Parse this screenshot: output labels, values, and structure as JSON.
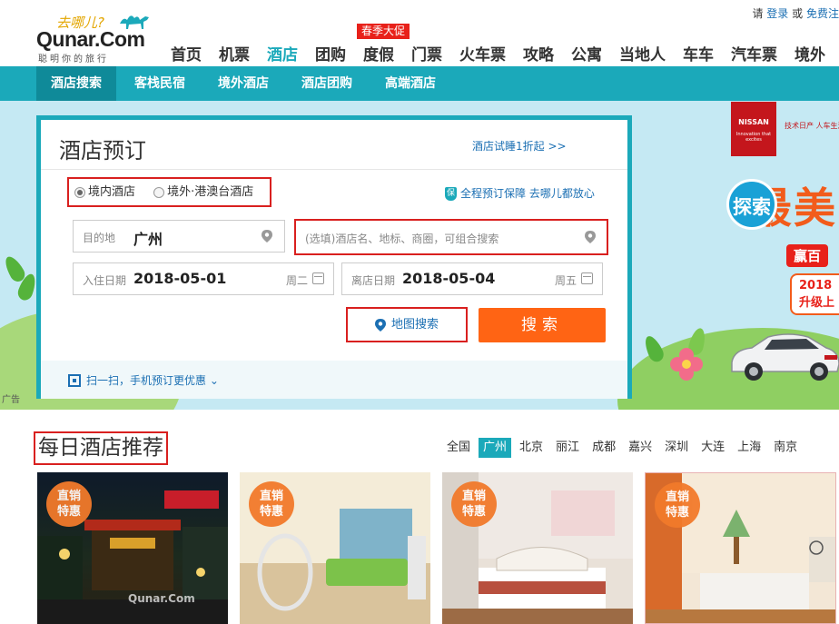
{
  "header": {
    "logo_slogan": "去哪儿?",
    "logo_name": "Qunar.Com",
    "logo_tagline": "聪明你的旅行",
    "top_links": {
      "prefix": "请",
      "login": "登录",
      "or": "或",
      "register": "免费注"
    },
    "promo_badge": "春季大促",
    "nav": [
      "首页",
      "机票",
      "酒店",
      "团购",
      "度假",
      "门票",
      "火车票",
      "攻略",
      "公寓",
      "当地人",
      "车车",
      "汽车票",
      "境外"
    ],
    "nav_active": "酒店"
  },
  "subnav": {
    "items": [
      "酒店搜索",
      "客栈民宿",
      "境外酒店",
      "酒店团购",
      "高端酒店"
    ],
    "active": "酒店搜索"
  },
  "hero_ad": {
    "brand": "NISSAN",
    "brand_small": "Innovation that excites",
    "tagline": "技术日产 人车生活",
    "explore": "探索",
    "big_word": "最美",
    "win_text": "赢百",
    "year_text": "2018",
    "upgrade_text": "升级上",
    "ad_label": "广告"
  },
  "booking": {
    "title": "酒店预订",
    "trial_link": "酒店试睡1折起 >>",
    "radio_domestic": "境内酒店",
    "radio_overseas": "境外·港澳台酒店",
    "guarantee": "全程预订保障 去哪儿都放心",
    "destination_label": "目的地",
    "destination_value": "广州",
    "keyword_placeholder": "(选填)酒店名、地标、商圈，可组合搜索",
    "checkin_label": "入住日期",
    "checkin_date": "2018-05-01",
    "checkin_day": "周二",
    "checkout_label": "离店日期",
    "checkout_date": "2018-05-04",
    "checkout_day": "周五",
    "map_search": "地图搜索",
    "search": "搜索",
    "scan_text": "扫一扫，手机预订更优惠"
  },
  "daily": {
    "title": "每日酒店推荐",
    "cities": [
      "全国",
      "广州",
      "北京",
      "丽江",
      "成都",
      "嘉兴",
      "深圳",
      "大连",
      "上海",
      "南京"
    ],
    "active_city": "广州",
    "badge_line1": "直销",
    "badge_line2": "特惠",
    "watermark": "Qunar.Com"
  },
  "colors": {
    "brand_teal": "#1ba9ba",
    "search_orange": "#ff6414",
    "highlight_red": "#d9201f",
    "link_blue": "#1b6fb3"
  }
}
